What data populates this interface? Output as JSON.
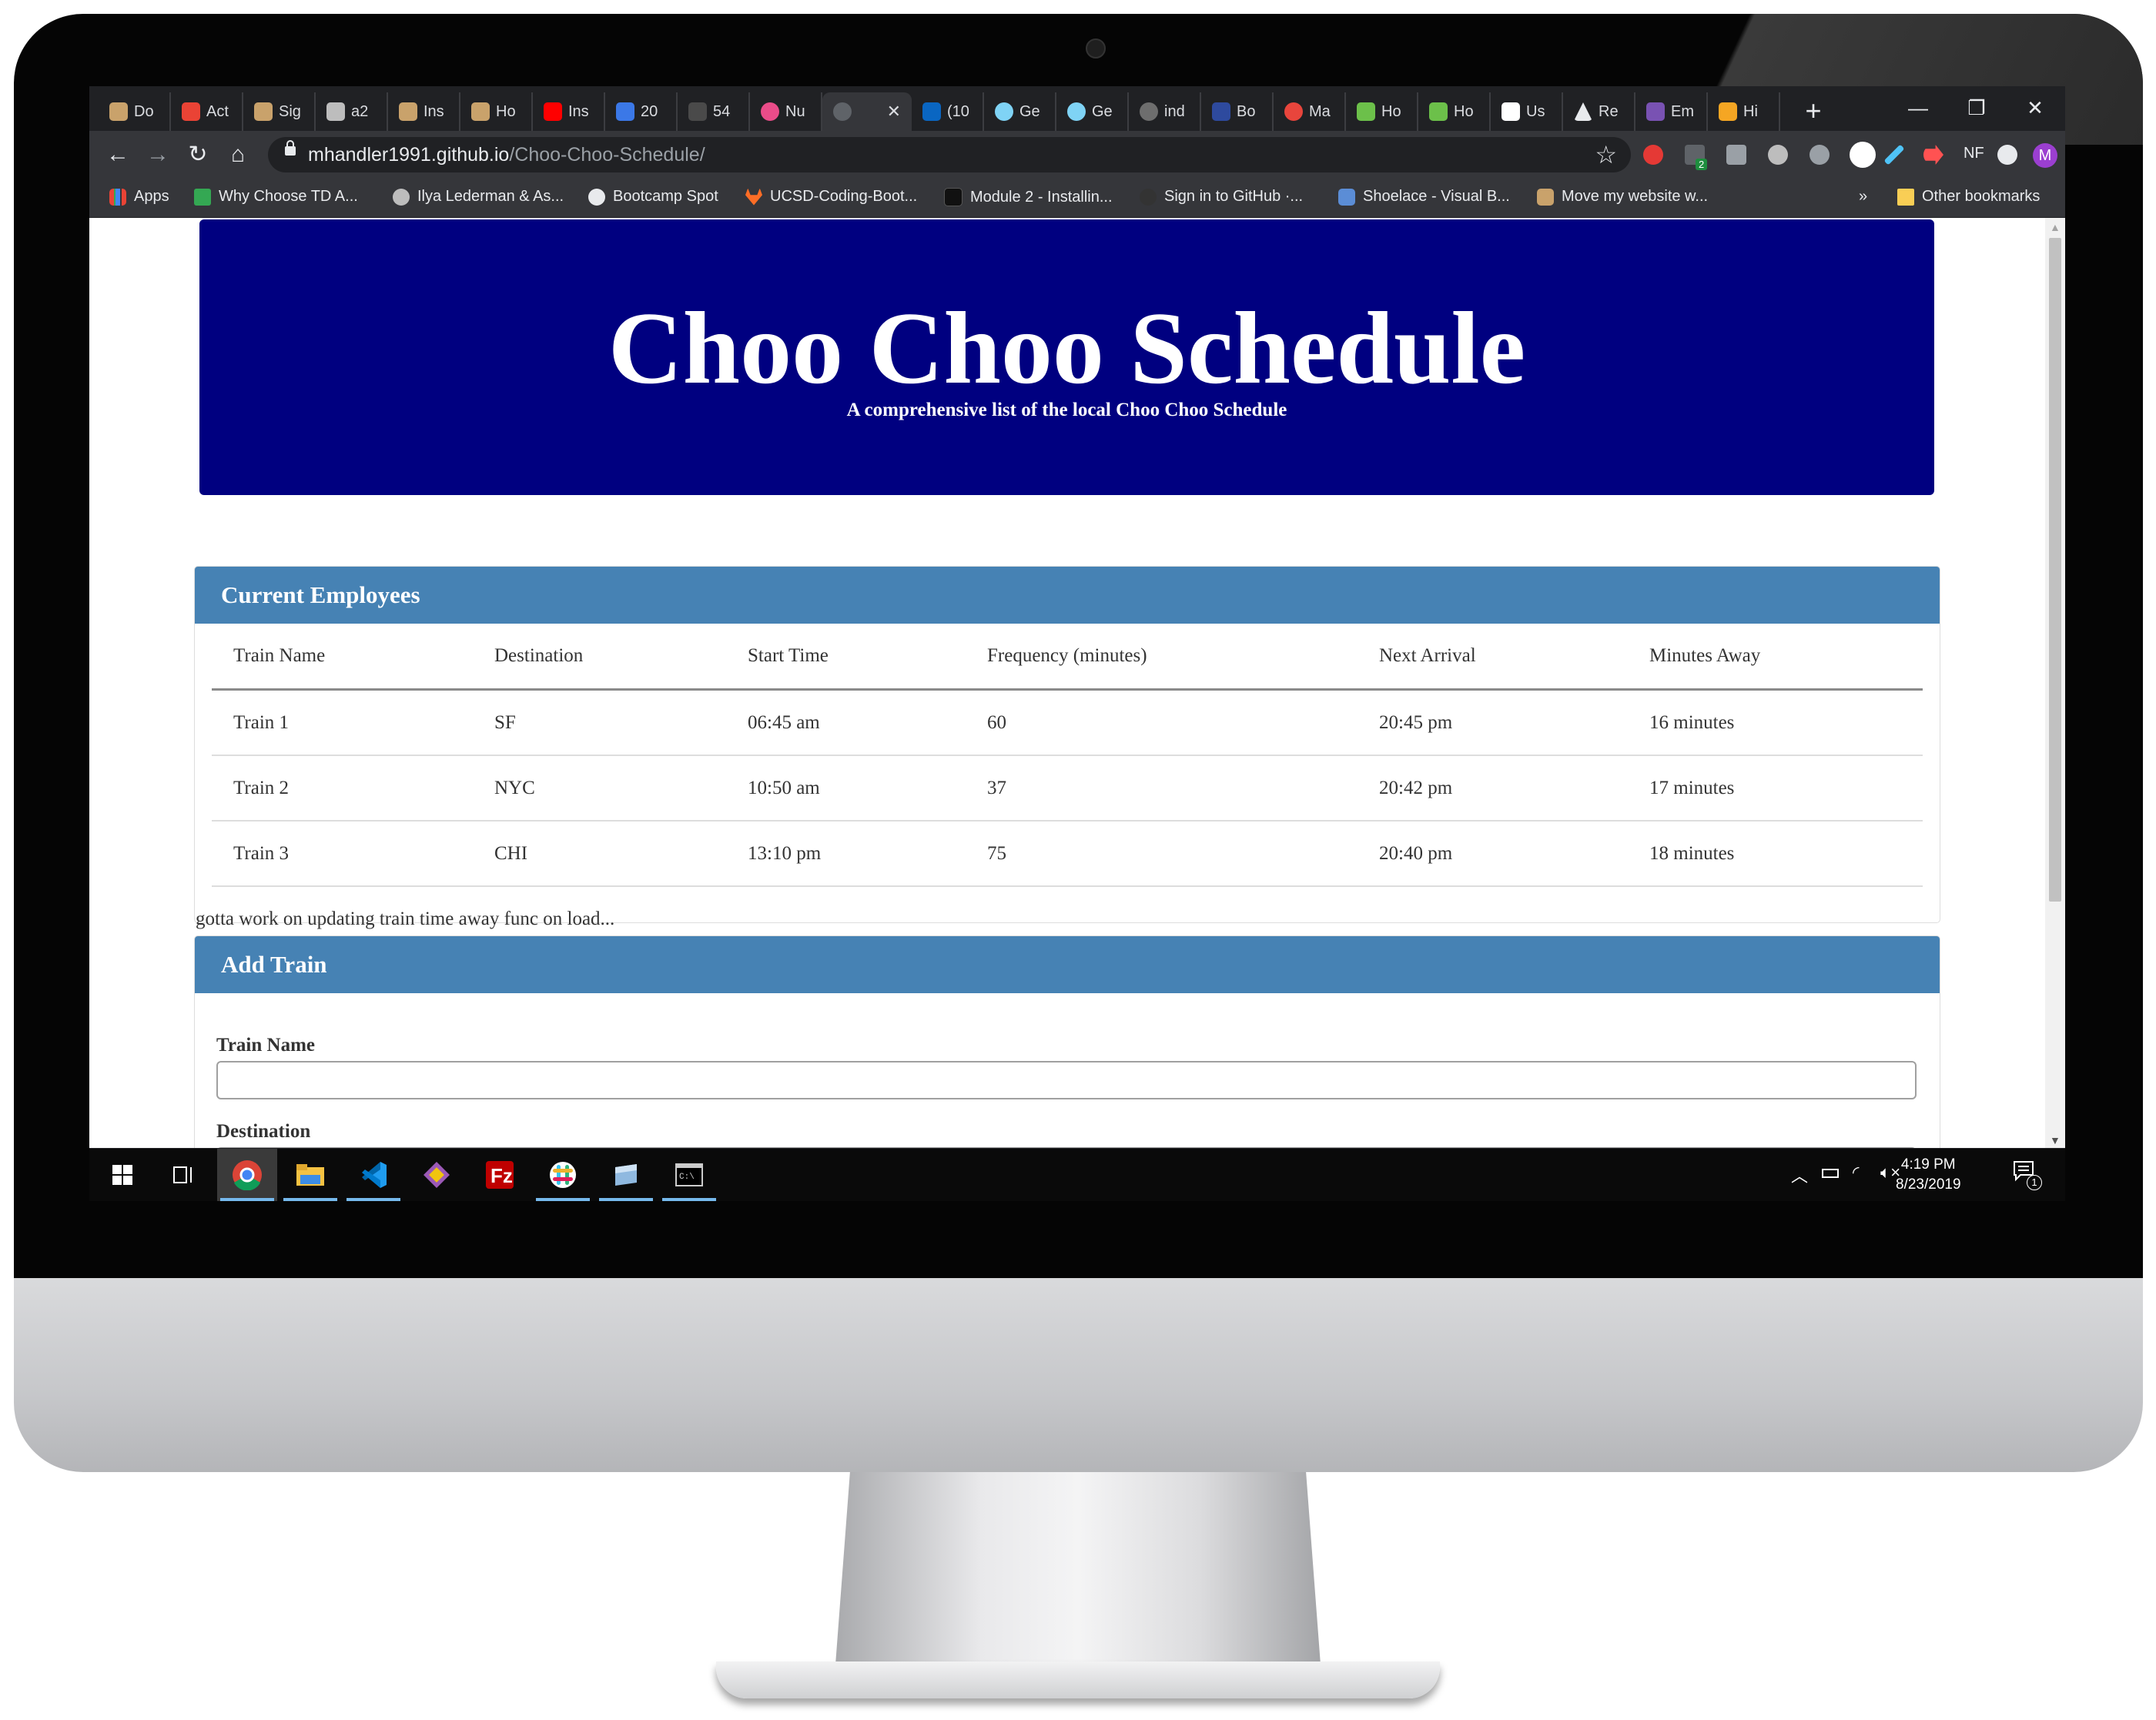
{
  "browser": {
    "tabs": [
      {
        "label": "Do"
      },
      {
        "label": "Act"
      },
      {
        "label": "Sig"
      },
      {
        "label": "a2"
      },
      {
        "label": "Ins"
      },
      {
        "label": "Ho"
      },
      {
        "label": "Ins"
      },
      {
        "label": "20"
      },
      {
        "label": "54"
      },
      {
        "label": "Nu"
      },
      {
        "label": ""
      },
      {
        "label": "(10"
      },
      {
        "label": "Ge"
      },
      {
        "label": "Ge"
      },
      {
        "label": "ind"
      },
      {
        "label": "Bo"
      },
      {
        "label": "Ma"
      },
      {
        "label": "Ho"
      },
      {
        "label": "Ho"
      },
      {
        "label": "Us"
      },
      {
        "label": "Re"
      },
      {
        "label": "Em"
      },
      {
        "label": "Hi"
      }
    ],
    "url_host": "mhandler1991.github.io",
    "url_path": "/Choo-Choo-Schedule/",
    "extensions": {
      "nf_label": "NF",
      "badge_count": "2"
    },
    "profile_initial": "M",
    "bookmarks": [
      {
        "label": "Apps"
      },
      {
        "label": "Why Choose TD A..."
      },
      {
        "label": "Ilya Lederman & As..."
      },
      {
        "label": "Bootcamp Spot"
      },
      {
        "label": "UCSD-Coding-Boot..."
      },
      {
        "label": "Module 2 - Installin..."
      },
      {
        "label": "Sign in to GitHub ·..."
      },
      {
        "label": "Shoelace - Visual B..."
      },
      {
        "label": "Move my website w..."
      }
    ],
    "more_bookmarks": "»",
    "other_bookmarks": "Other bookmarks"
  },
  "page": {
    "title": "Choo Choo Schedule",
    "subtitle": "A comprehensive list of the local Choo Choo Schedule",
    "employees_heading": "Current Employees",
    "table": {
      "headers": [
        "Train Name",
        "Destination",
        "Start Time",
        "Frequency (minutes)",
        "Next Arrival",
        "Minutes Away"
      ],
      "rows": [
        [
          "Train 1",
          "SF",
          "06:45 am",
          "60",
          "20:45 pm",
          "16 minutes"
        ],
        [
          "Train 2",
          "NYC",
          "10:50 am",
          "37",
          "20:42 pm",
          "17 minutes"
        ],
        [
          "Train 3",
          "CHI",
          "13:10 pm",
          "75",
          "20:40 pm",
          "18 minutes"
        ]
      ]
    },
    "note": "gotta work on updating train time away func on load...",
    "add_heading": "Add Train",
    "form": {
      "train_name_label": "Train Name",
      "train_name_value": "",
      "destination_label": "Destination"
    }
  },
  "taskbar": {
    "time": "4:19 PM",
    "date": "8/23/2019",
    "notification_count": "1"
  },
  "colors": {
    "jumbotron": "#000080",
    "panel_heading": "#4682b4",
    "chrome_dark": "#202124",
    "chrome_toolbar": "#35363a"
  }
}
